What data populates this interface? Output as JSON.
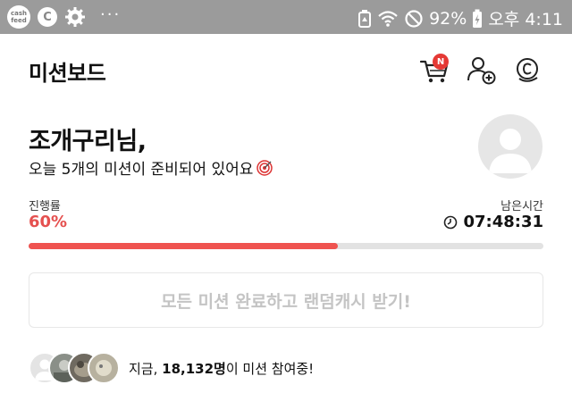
{
  "status_bar": {
    "cashfeed_label": "cash feed",
    "c_icon_label": "C",
    "overflow": "···",
    "battery_percent": "92%",
    "time": "오후 4:11"
  },
  "header": {
    "title": "미션보드",
    "cart_badge": "N"
  },
  "greeting": {
    "name": "조개구리님,",
    "message": "오늘 5개의 미션이 준비되어 있어요"
  },
  "progress": {
    "label": "진행률",
    "value_text": "60%",
    "fraction": 0.6,
    "time_label": "남은시간",
    "time_value": "07:48:31"
  },
  "claim_button": {
    "label": "모든 미션 완료하고 랜덤캐시 받기!"
  },
  "participants": {
    "prefix": "지금, ",
    "count": "18,132명",
    "suffix": "이 미션 참여중!"
  },
  "colors": {
    "accent": "#ef5350",
    "status_bar": "#9b9b9b",
    "disabled_text": "#c4c4c4"
  }
}
